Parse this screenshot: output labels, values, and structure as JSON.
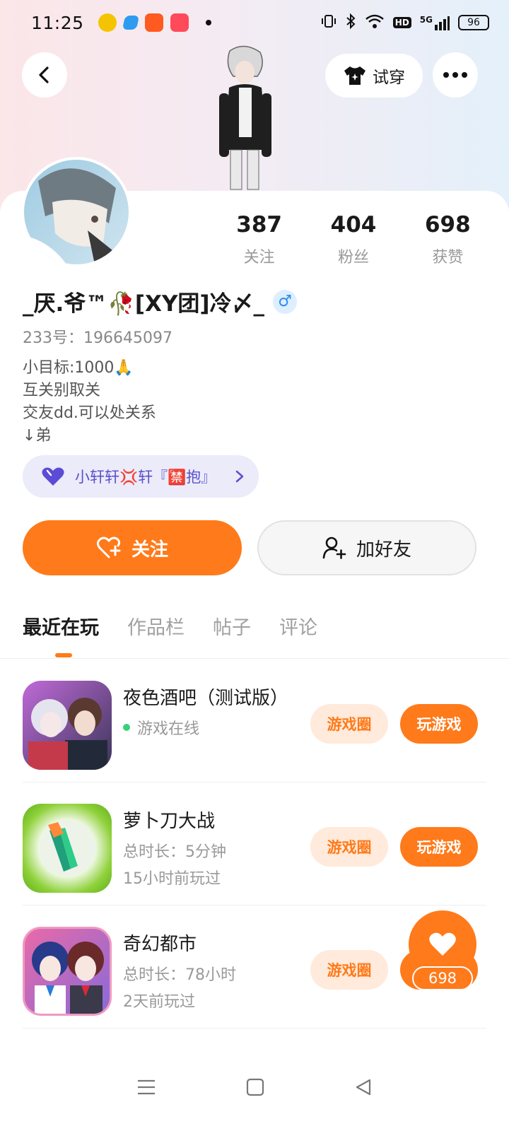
{
  "status_bar": {
    "time": "11:25",
    "battery": "96",
    "network": "5G",
    "hd": "HD",
    "app_icons": [
      "weibo-icon",
      "blue-app-icon",
      "orange-app-icon",
      "pink-app-icon"
    ]
  },
  "header": {
    "try_on_label": "试穿"
  },
  "profile": {
    "stats": [
      {
        "value": "387",
        "label": "关注"
      },
      {
        "value": "404",
        "label": "粉丝"
      },
      {
        "value": "698",
        "label": "获赞"
      }
    ],
    "name": "_厌.爷™🥀[XY团]冷〆_",
    "gender_symbol": "♂",
    "uid": "233号：196645097",
    "bio": [
      "小目标:1000🙏",
      "互关别取关",
      "交友dd.可以处关系",
      "↓弟"
    ],
    "group_label": "小轩轩💢轩『🈲抱』"
  },
  "actions": {
    "follow_label": "关注",
    "add_friend_label": "加好友"
  },
  "tabs": [
    {
      "label": "最近在玩",
      "active": true
    },
    {
      "label": "作品栏",
      "active": false
    },
    {
      "label": "帖子",
      "active": false
    },
    {
      "label": "评论",
      "active": false
    }
  ],
  "games": [
    {
      "title": "夜色酒吧（测试版）",
      "sub1": "游戏在线",
      "sub2": "",
      "online": true,
      "circle_label": "游戏圈",
      "play_label": "玩游戏"
    },
    {
      "title": "萝卜刀大战",
      "sub1": "总时长：5分钟",
      "sub2": "15小时前玩过",
      "online": false,
      "circle_label": "游戏圈",
      "play_label": "玩游戏"
    },
    {
      "title": "奇幻都市",
      "sub1": "总时长：78小时",
      "sub2": "2天前玩过",
      "online": false,
      "circle_label": "游戏圈",
      "play_label": "玩游戏"
    }
  ],
  "floating": {
    "like_count": "698"
  },
  "colors": {
    "accent": "#ff7a1a",
    "accent_soft": "#ffeadb",
    "online_green": "#2cb86a",
    "group_purple": "#5b51c9",
    "gender_blue": "#2d8ce8"
  }
}
